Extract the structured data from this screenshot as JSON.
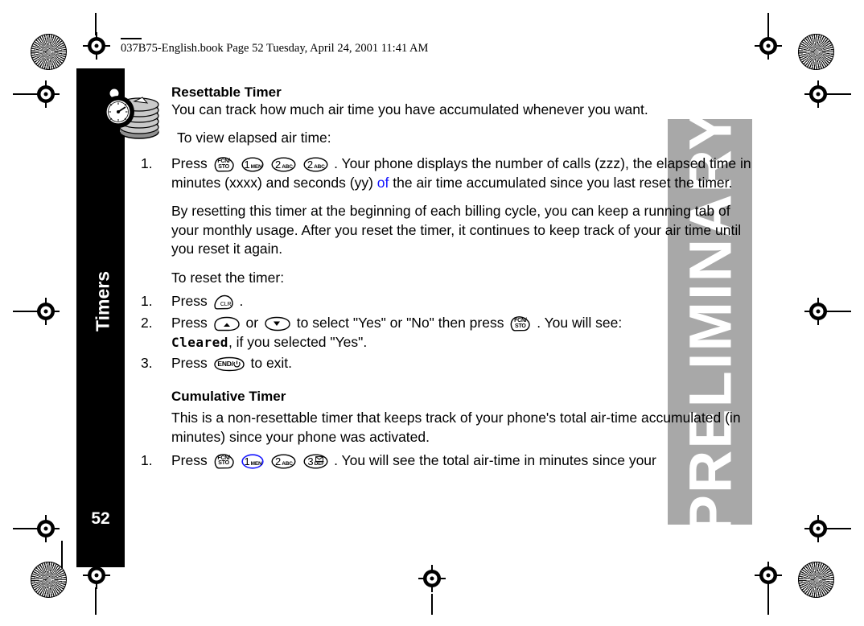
{
  "document": {
    "header_line": "037B75-English.book  Page 52  Tuesday, April 24, 2001  11:41 AM",
    "page_number": "52",
    "side_tab_label": "Timers",
    "watermark": "PRELIMINARY",
    "watermark_color": "#a8a8a8",
    "edit_color": "#1414ff"
  },
  "sections": {
    "resettable": {
      "heading": "Resettable Timer",
      "intro": "You can track how much air time you have accumulated whenever you want.",
      "lead_in": "To view elapsed air time:",
      "step1": {
        "number": "1.",
        "press_label": "Press",
        "keys": [
          "fcn-sto",
          "1-men",
          "2-abc",
          "2-abc"
        ],
        "text_a": ". Your phone displays the number of calls (zzz), the elapsed time in minutes (xxxx) and seconds (yy) ",
        "edit_word": "of",
        "text_b": " the air time accumulated since you last reset the timer."
      },
      "paragraph": "By resetting this timer at the beginning of each billing cycle, you can keep a running tab of your monthly usage. After you reset the timer, it continues to keep track of your air time until you reset it again.",
      "reset_lead_in": "To reset the timer:",
      "reset_steps": [
        {
          "number": "1.",
          "press_label": "Press",
          "keys": [
            "clr"
          ],
          "after": "."
        },
        {
          "number": "2.",
          "press_label": "Press",
          "keys": [
            "up-arrow"
          ],
          "middle_1": " or ",
          "keys_2": [
            "down-arrow"
          ],
          "middle_2": "to select \"Yes\" or \"No\" then press ",
          "keys_3": [
            "fcn-sto"
          ],
          "after": ". You will see:",
          "display_text": "Cleared",
          "display_after": ", if you selected \"Yes\"."
        },
        {
          "number": "3.",
          "press_label": "Press",
          "keys": [
            "end-pwr"
          ],
          "after": " to exit."
        }
      ]
    },
    "cumulative": {
      "heading": "Cumulative Timer",
      "body": "This is a non-resettable timer that keeps track of your phone's total air-time accumulated (in minutes) since your phone was activated.",
      "step1": {
        "number": "1.",
        "press_label": "Press",
        "keys": [
          "fcn-sto",
          "1-men-blue",
          "2-abc",
          "3-def-mail"
        ],
        "after": ". You will see the total air-time in minutes since your"
      }
    }
  },
  "keys": {
    "fcn-sto": {
      "line1": "FCN/",
      "line2": "STO",
      "shape": "rounded-triangle"
    },
    "1-men": {
      "num": "1",
      "sub": "MEN",
      "shape": "oval"
    },
    "1-men-blue": {
      "num": "1",
      "sub": "MEN",
      "shape": "oval",
      "color": "#1414ff"
    },
    "2-abc": {
      "num": "2",
      "sub": "ABC",
      "shape": "oval"
    },
    "3-def-mail": {
      "num": "3",
      "sub": "DEF",
      "glyph": "envelope",
      "shape": "oval"
    },
    "clr": {
      "label": "CLR",
      "shape": "clr-blob"
    },
    "up-arrow": {
      "glyph": "triangle-up",
      "shape": "wide-oval"
    },
    "down-arrow": {
      "glyph": "triangle-down",
      "shape": "wide-oval"
    },
    "end-pwr": {
      "label": "END/",
      "glyph": "power",
      "shape": "oval"
    }
  }
}
